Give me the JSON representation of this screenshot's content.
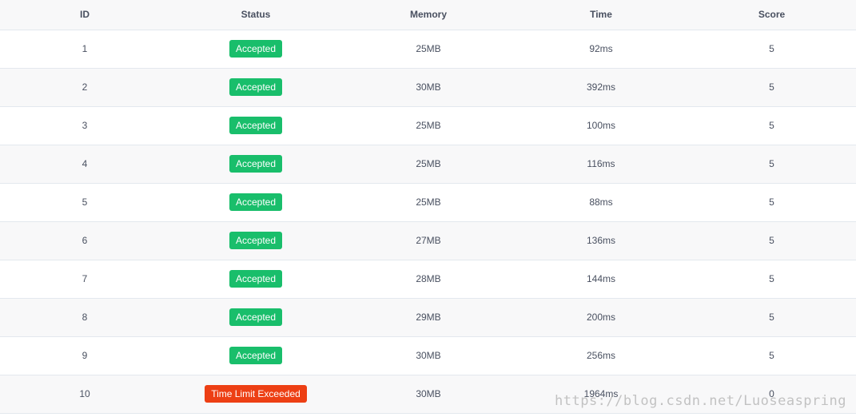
{
  "table": {
    "headers": {
      "id": "ID",
      "status": "Status",
      "memory": "Memory",
      "time": "Time",
      "score": "Score"
    },
    "rows": [
      {
        "id": "1",
        "status": "Accepted",
        "memory": "25MB",
        "time": "92ms",
        "score": "5"
      },
      {
        "id": "2",
        "status": "Accepted",
        "memory": "30MB",
        "time": "392ms",
        "score": "5"
      },
      {
        "id": "3",
        "status": "Accepted",
        "memory": "25MB",
        "time": "100ms",
        "score": "5"
      },
      {
        "id": "4",
        "status": "Accepted",
        "memory": "25MB",
        "time": "116ms",
        "score": "5"
      },
      {
        "id": "5",
        "status": "Accepted",
        "memory": "25MB",
        "time": "88ms",
        "score": "5"
      },
      {
        "id": "6",
        "status": "Accepted",
        "memory": "27MB",
        "time": "136ms",
        "score": "5"
      },
      {
        "id": "7",
        "status": "Accepted",
        "memory": "28MB",
        "time": "144ms",
        "score": "5"
      },
      {
        "id": "8",
        "status": "Accepted",
        "memory": "29MB",
        "time": "200ms",
        "score": "5"
      },
      {
        "id": "9",
        "status": "Accepted",
        "memory": "30MB",
        "time": "256ms",
        "score": "5"
      },
      {
        "id": "10",
        "status": "Time Limit Exceeded",
        "memory": "30MB",
        "time": "1964ms",
        "score": "0"
      }
    ]
  },
  "colors": {
    "accepted": "#19be6b",
    "time_limit_exceeded": "#ed3f14",
    "text": "#495060",
    "header_bg": "#f8f8f9",
    "border": "#e3e8ee"
  },
  "watermark": "https://blog.csdn.net/Luoseaspring"
}
